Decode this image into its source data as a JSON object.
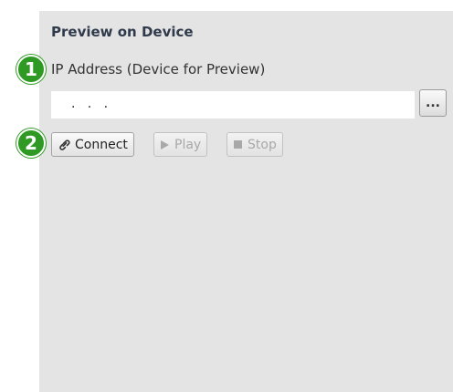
{
  "panel": {
    "title": "Preview on Device",
    "ip_label": "IP Address (Device for Preview)",
    "ip_value": ".   .   .",
    "browse_label": "...",
    "buttons": {
      "connect": "Connect",
      "play": "Play",
      "stop": "Stop"
    }
  },
  "callouts": {
    "one": "1",
    "two": "2"
  },
  "colors": {
    "panel_bg": "#e4e4e4",
    "badge_green": "#2f9a23",
    "disabled_text": "#a8a8a8"
  }
}
